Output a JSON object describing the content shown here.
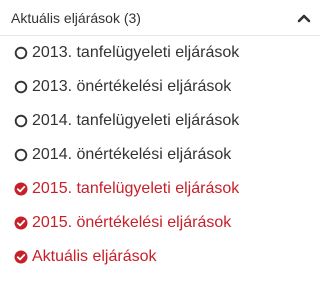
{
  "header": {
    "title": "Aktuális eljárások (3)"
  },
  "colors": {
    "text": "#333333",
    "accent": "#c8202a"
  },
  "items": [
    {
      "label": "2013. tanfelügyeleti eljárások",
      "icon": "circle-outline-icon",
      "checked": false
    },
    {
      "label": "2013. önértékelési eljárások",
      "icon": "circle-outline-icon",
      "checked": false
    },
    {
      "label": "2014. tanfelügyeleti eljárások",
      "icon": "circle-outline-icon",
      "checked": false
    },
    {
      "label": "2014. önértékelési eljárások",
      "icon": "circle-outline-icon",
      "checked": false
    },
    {
      "label": "2015. tanfelügyeleti eljárások",
      "icon": "check-circle-icon",
      "checked": true
    },
    {
      "label": "2015. önértékelési eljárások",
      "icon": "check-circle-icon",
      "checked": true
    },
    {
      "label": "Aktuális eljárások",
      "icon": "check-circle-icon",
      "checked": true
    }
  ]
}
